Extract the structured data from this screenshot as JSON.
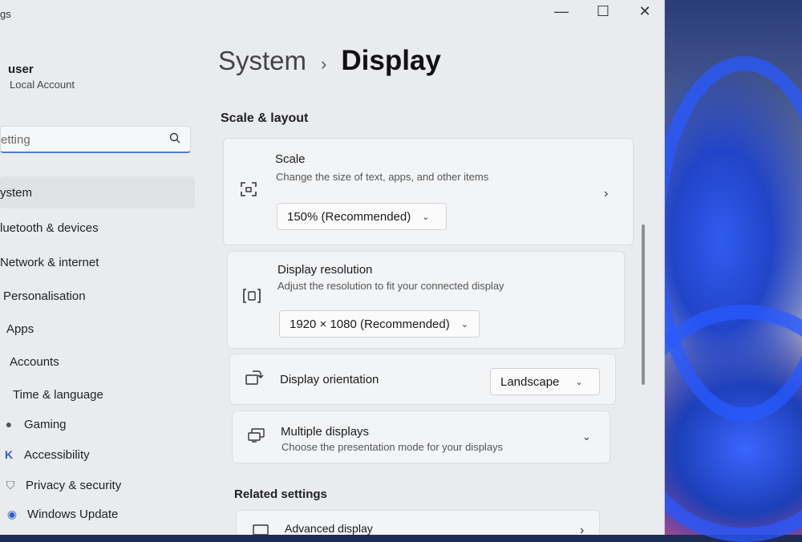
{
  "window": {
    "app_title": "gs",
    "minimize": "—",
    "maximize": "☐",
    "close": "✕"
  },
  "sidebar": {
    "user_name": "user",
    "user_sub": "Local Account",
    "search_placeholder": "etting",
    "items": [
      {
        "label": "ystem",
        "icon": ""
      },
      {
        "label": "luetooth & devices",
        "icon": ""
      },
      {
        "label": "Network & internet",
        "icon": ""
      },
      {
        "label": "Personalisation",
        "icon": ""
      },
      {
        "label": "Apps",
        "icon": ""
      },
      {
        "label": "Accounts",
        "icon": ""
      },
      {
        "label": "Time & language",
        "icon": ""
      },
      {
        "label": "Gaming",
        "icon": "●"
      },
      {
        "label": "Accessibility",
        "icon": "K"
      },
      {
        "label": "Privacy & security",
        "icon": "⛉"
      },
      {
        "label": "Windows Update",
        "icon": "◉"
      }
    ]
  },
  "breadcrumb": {
    "parent": "System",
    "separator": "›",
    "current": "Display"
  },
  "scale_layout": {
    "title": "Scale & layout",
    "scale": {
      "title": "Scale",
      "subtitle": "Change the size of text, apps, and other items",
      "value": "150% (Recommended)"
    },
    "resolution": {
      "title": "Display resolution",
      "subtitle": "Adjust the resolution to fit your connected display",
      "value": "1920 × 1080 (Recommended)"
    },
    "orientation": {
      "title": "Display orientation",
      "value": "Landscape"
    },
    "multiple": {
      "title": "Multiple displays",
      "subtitle": "Choose the presentation mode for your displays"
    }
  },
  "related": {
    "title": "Related settings",
    "advanced": "Advanced display"
  },
  "colors": {
    "accent": "#4a7fd0",
    "window_bg": "#e9ebee",
    "card_bg": "#f3f4f6"
  }
}
